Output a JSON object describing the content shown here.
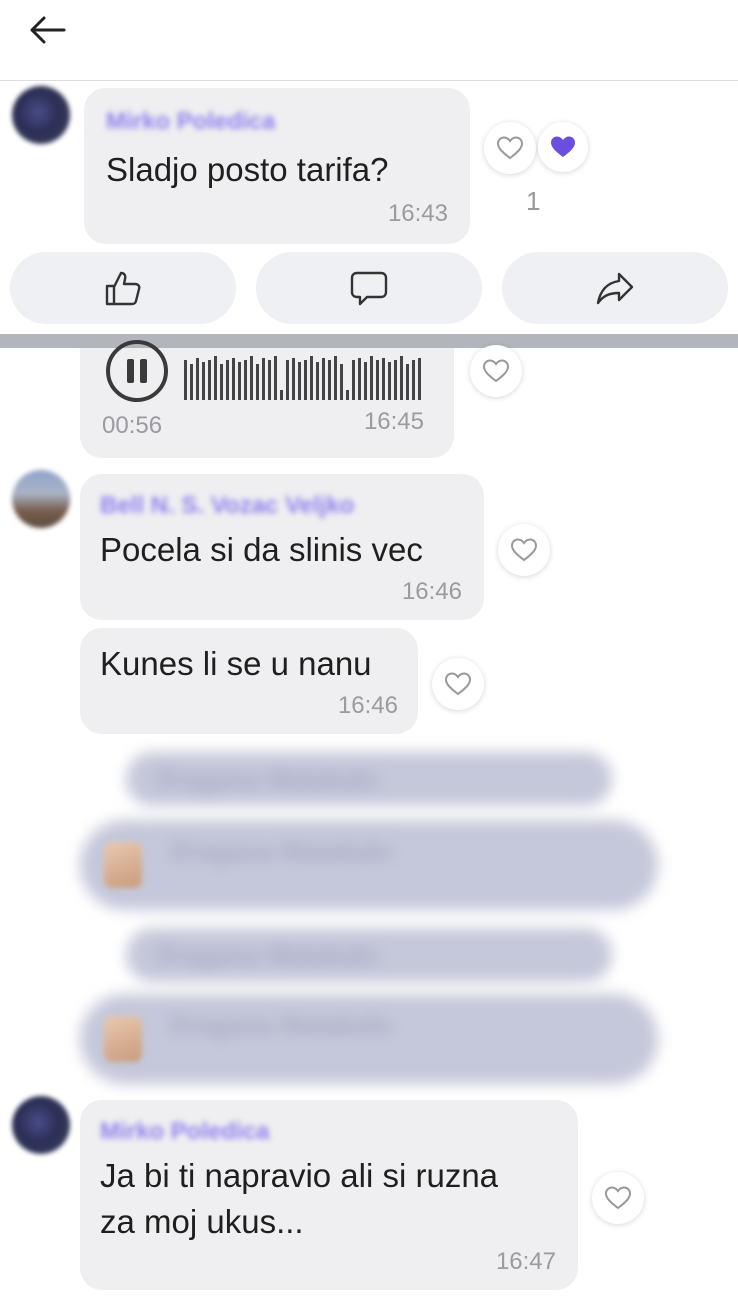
{
  "header": {
    "back_icon": "arrow-left-icon"
  },
  "messages": {
    "m1": {
      "sender": "Mirko Poledica",
      "text": "Sladjo posto tarifa?",
      "time": "16:43",
      "reaction_count": "1"
    },
    "audio": {
      "duration": "00:56",
      "time": "16:45"
    },
    "m2": {
      "sender": "Bell N. S. Vozac Veljko",
      "text": "Pocela si da slinis vec",
      "time": "16:46"
    },
    "m3": {
      "text": "Kunes li se u nanu",
      "time": "16:46"
    },
    "m4": {
      "sender": "Mirko Poledica",
      "line1": "Ja bi ti napravio ali si ruzna",
      "line2": "za moj ukus...",
      "time": "16:47"
    }
  },
  "blurred_items": [
    {
      "text": "Dragana Matakalo"
    },
    {
      "text": "Dragana Matakalo"
    },
    {
      "text": "Dragana Matakalo"
    },
    {
      "text": "Dragana Matakalo"
    }
  ],
  "actions": {
    "like_icon": "thumbs-up-icon",
    "comment_icon": "comment-icon",
    "share_icon": "share-icon"
  },
  "colors": {
    "accent": "#6a4ee0",
    "bubble": "#efeff1",
    "sender": "#8d80ee"
  }
}
